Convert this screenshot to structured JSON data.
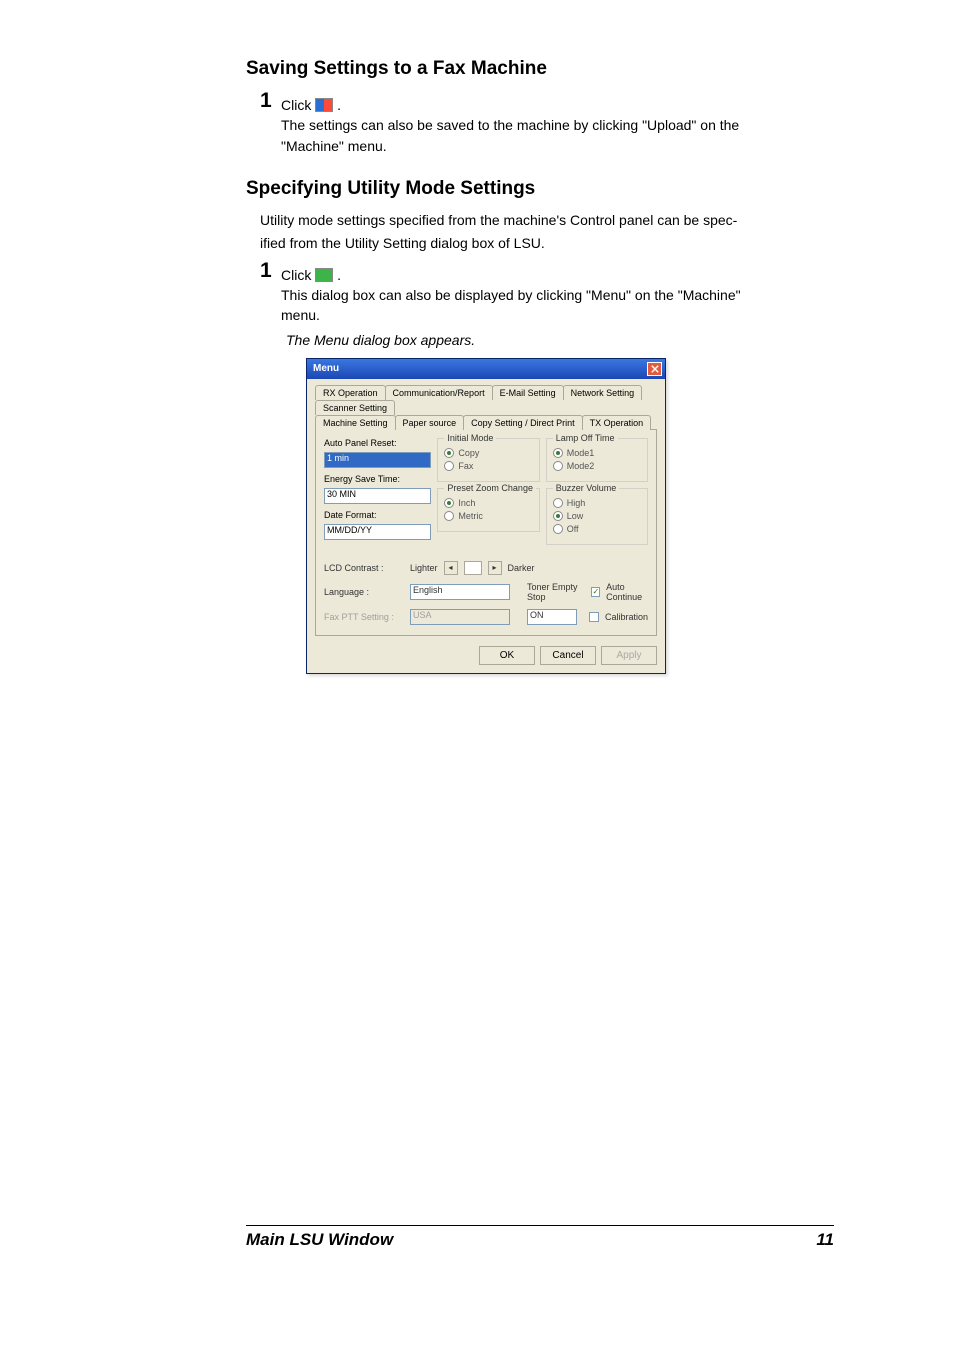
{
  "sec1": {
    "heading": "Saving Settings to a Fax Machine",
    "step_num": "1",
    "click": "Click ",
    "dot": " .",
    "line2a": "The settings can also be saved to the machine by clicking \"Upload\" on the",
    "line2b": "\"Machine\" menu."
  },
  "sec2": {
    "heading": "Specifying Utility Mode Settings",
    "intro1": "Utility mode settings specified from the machine's Control panel can be spec-",
    "intro2": "ified from the Utility Setting dialog box of LSU.",
    "step_num": "1",
    "click": "Click ",
    "dot": " .",
    "line2a": "This dialog box can also be displayed by clicking \"Menu\" on the \"Machine\"",
    "line2b": "menu.",
    "appears": "The Menu dialog box appears."
  },
  "dlg": {
    "title": "Menu",
    "tabs_row1": [
      "RX Operation",
      "Communication/Report",
      "E-Mail Setting",
      "Network Setting",
      "Scanner Setting"
    ],
    "tabs_row2": [
      "Machine Setting",
      "Paper source",
      "Copy Setting / Direct Print",
      "TX Operation"
    ],
    "active_tab": "Machine Setting",
    "auto_panel_reset": {
      "label": "Auto Panel Reset:",
      "value": "1 min"
    },
    "energy_save": {
      "label": "Energy Save Time:",
      "value": "30 MIN"
    },
    "date_format": {
      "label": "Date Format:",
      "value": "MM/DD/YY"
    },
    "initial_mode": {
      "label": "Initial Mode",
      "opt1": "Copy",
      "opt2": "Fax",
      "checked": "opt1"
    },
    "preset_zoom": {
      "label": "Preset Zoom Change",
      "opt1": "Inch",
      "opt2": "Metric",
      "checked": "opt1"
    },
    "lamp_off": {
      "label": "Lamp Off Time",
      "opt1": "Mode1",
      "opt2": "Mode2",
      "checked": "opt1"
    },
    "buzzer": {
      "label": "Buzzer Volume",
      "opt1": "High",
      "opt2": "Low",
      "opt3": "Off",
      "checked": "opt2"
    },
    "lcd": {
      "label": "LCD Contrast :",
      "left": "Lighter",
      "right": "Darker"
    },
    "language": {
      "label": "Language :",
      "value": "English"
    },
    "faxptt": {
      "label": "Fax PTT Setting :",
      "value": "USA"
    },
    "toner_empty": {
      "label": "Toner Empty Stop",
      "value": "ON"
    },
    "auto_continue": "Auto Continue",
    "calibration": "Calibration",
    "buttons": {
      "ok": "OK",
      "cancel": "Cancel",
      "apply": "Apply"
    }
  },
  "chart_data": {
    "type": "table",
    "title": "Menu — Machine Setting tab (field values)",
    "fields": [
      {
        "field": "Auto Panel Reset",
        "value": "1 min",
        "control": "dropdown"
      },
      {
        "field": "Energy Save Time",
        "value": "30 MIN",
        "control": "dropdown"
      },
      {
        "field": "Date Format",
        "value": "MM/DD/YY",
        "control": "dropdown"
      },
      {
        "field": "Initial Mode",
        "value": "Copy",
        "options": [
          "Copy",
          "Fax"
        ],
        "control": "radio"
      },
      {
        "field": "Preset Zoom Change",
        "value": "Inch",
        "options": [
          "Inch",
          "Metric"
        ],
        "control": "radio"
      },
      {
        "field": "Lamp Off Time",
        "value": "Mode1",
        "options": [
          "Mode1",
          "Mode2"
        ],
        "control": "radio"
      },
      {
        "field": "Buzzer Volume",
        "value": "Low",
        "options": [
          "High",
          "Low",
          "Off"
        ],
        "control": "radio"
      },
      {
        "field": "LCD Contrast",
        "value": "mid",
        "range": [
          "Lighter",
          "Darker"
        ],
        "control": "slider"
      },
      {
        "field": "Language",
        "value": "English",
        "control": "dropdown"
      },
      {
        "field": "Fax PTT Setting",
        "value": "USA",
        "control": "dropdown",
        "enabled": false
      },
      {
        "field": "Toner Empty Stop",
        "value": "ON",
        "control": "dropdown"
      },
      {
        "field": "Auto Continue",
        "value": true,
        "control": "checkbox"
      },
      {
        "field": "Calibration",
        "value": false,
        "control": "checkbox"
      }
    ]
  },
  "footer": {
    "left": "Main LSU Window",
    "right": "11"
  }
}
